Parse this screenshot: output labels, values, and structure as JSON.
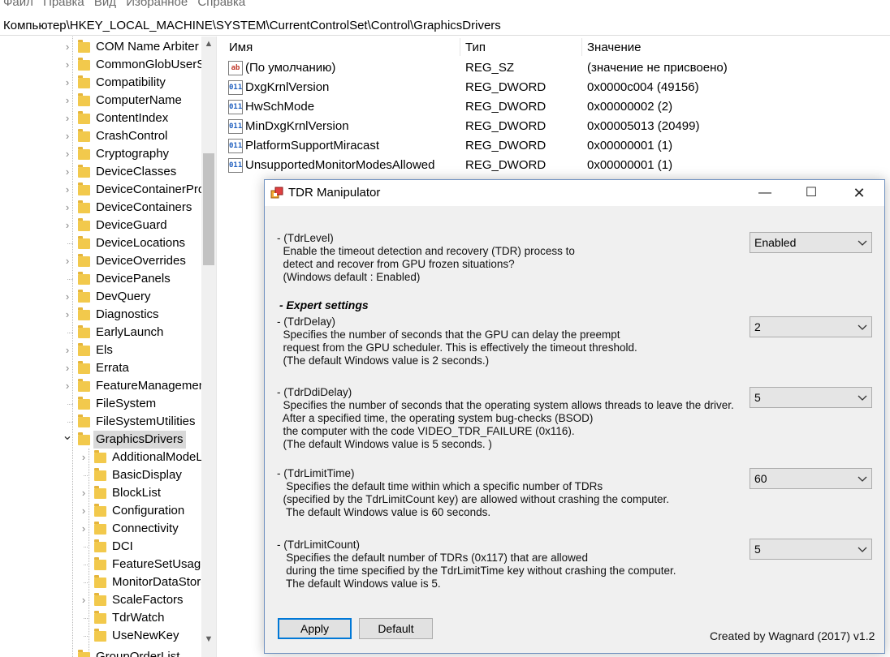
{
  "menu": [
    "Файл",
    "Правка",
    "Вид",
    "Избранное",
    "Справка"
  ],
  "address": "Компьютер\\HKEY_LOCAL_MACHINE\\SYSTEM\\CurrentControlSet\\Control\\GraphicsDrivers",
  "tree": {
    "items": [
      {
        "label": "COM Name Arbiter",
        "expand": true
      },
      {
        "label": "CommonGlobUserSettings",
        "expand": true
      },
      {
        "label": "Compatibility",
        "expand": true
      },
      {
        "label": "ComputerName",
        "expand": true
      },
      {
        "label": "ContentIndex",
        "expand": true
      },
      {
        "label": "CrashControl",
        "expand": true
      },
      {
        "label": "Cryptography",
        "expand": true
      },
      {
        "label": "DeviceClasses",
        "expand": true
      },
      {
        "label": "DeviceContainerPropertyUpdateEvents",
        "expand": true
      },
      {
        "label": "DeviceContainers",
        "expand": true
      },
      {
        "label": "DeviceGuard",
        "expand": true
      },
      {
        "label": "DeviceLocations",
        "expand": false
      },
      {
        "label": "DeviceOverrides",
        "expand": true
      },
      {
        "label": "DevicePanels",
        "expand": false
      },
      {
        "label": "DevQuery",
        "expand": true
      },
      {
        "label": "Diagnostics",
        "expand": true
      },
      {
        "label": "EarlyLaunch",
        "expand": false
      },
      {
        "label": "Els",
        "expand": true
      },
      {
        "label": "Errata",
        "expand": true
      },
      {
        "label": "FeatureManagement",
        "expand": true
      },
      {
        "label": "FileSystem",
        "expand": false
      },
      {
        "label": "FileSystemUtilities",
        "expand": false
      },
      {
        "label": "GraphicsDrivers",
        "expand": "open",
        "selected": true
      }
    ],
    "children": [
      {
        "label": "AdditionalModeLists",
        "expand": true
      },
      {
        "label": "BasicDisplay",
        "expand": false
      },
      {
        "label": "BlockList",
        "expand": true
      },
      {
        "label": "Configuration",
        "expand": true
      },
      {
        "label": "Connectivity",
        "expand": true
      },
      {
        "label": "DCI",
        "expand": false
      },
      {
        "label": "FeatureSetUsage",
        "expand": false
      },
      {
        "label": "MonitorDataStore",
        "expand": false
      },
      {
        "label": "ScaleFactors",
        "expand": true
      },
      {
        "label": "TdrWatch",
        "expand": false
      },
      {
        "label": "UseNewKey",
        "expand": false
      }
    ],
    "partial_bottom": "GroupOrderList"
  },
  "values": {
    "headers": {
      "name": "Имя",
      "type": "Тип",
      "data": "Значение"
    },
    "rows": [
      {
        "icon": "string-value-icon",
        "glyph": "ab",
        "name": "(По умолчанию)",
        "type": "REG_SZ",
        "data": "(значение не присвоено)"
      },
      {
        "icon": "binary-value-icon",
        "glyph": "011",
        "name": "DxgKrnlVersion",
        "type": "REG_DWORD",
        "data": "0x0000c004 (49156)"
      },
      {
        "icon": "binary-value-icon",
        "glyph": "011",
        "name": "HwSchMode",
        "type": "REG_DWORD",
        "data": "0x00000002 (2)"
      },
      {
        "icon": "binary-value-icon",
        "glyph": "011",
        "name": "MinDxgKrnlVersion",
        "type": "REG_DWORD",
        "data": "0x00005013 (20499)"
      },
      {
        "icon": "binary-value-icon",
        "glyph": "011",
        "name": "PlatformSupportMiracast",
        "type": "REG_DWORD",
        "data": "0x00000001 (1)"
      },
      {
        "icon": "binary-value-icon",
        "glyph": "011",
        "name": "UnsupportedMonitorModesAllowed",
        "type": "REG_DWORD",
        "data": "0x00000001 (1)"
      }
    ]
  },
  "dialog": {
    "title": "TDR Manipulator",
    "minimize": "—",
    "maximize": "☐",
    "close": "✕",
    "tdrlevel": {
      "text": "- (TdrLevel)\n  Enable the timeout detection and recovery (TDR) process to\n  detect and recover from GPU frozen situations?\n  (Windows default : Enabled)",
      "value": "Enabled"
    },
    "expert_heading": "- Expert settings",
    "tdrdelay": {
      "text": "- (TdrDelay)\n  Specifies the number of seconds that the GPU can delay the preempt\n  request from the GPU scheduler. This is effectively the timeout threshold.\n  (The default Windows value is 2 seconds.)",
      "value": "2"
    },
    "tdrddidelay": {
      "text": "- (TdrDdiDelay)\n  Specifies the number of seconds that the operating system allows threads to leave the driver.\n  After a specified time, the operating system bug-checks (BSOD)\n  the computer with the code VIDEO_TDR_FAILURE (0x116).\n  (The default Windows value is 5 seconds. )",
      "value": "5"
    },
    "tdrlimittime": {
      "text": "- (TdrLimitTime)\n   Specifies the default time within which a specific number of TDRs\n  (specified by the TdrLimitCount key) are allowed without crashing the computer.\n   The default Windows value is 60 seconds.",
      "value": "60"
    },
    "tdrlimitcount": {
      "text": "- (TdrLimitCount)\n   Specifies the default number of TDRs (0x117) that are allowed\n   during the time specified by the TdrLimitTime key without crashing the computer.\n   The default Windows value is 5.",
      "value": "5"
    },
    "apply": "Apply",
    "default": "Default",
    "credit": "Created by Wagnard (2017) v1.2"
  }
}
